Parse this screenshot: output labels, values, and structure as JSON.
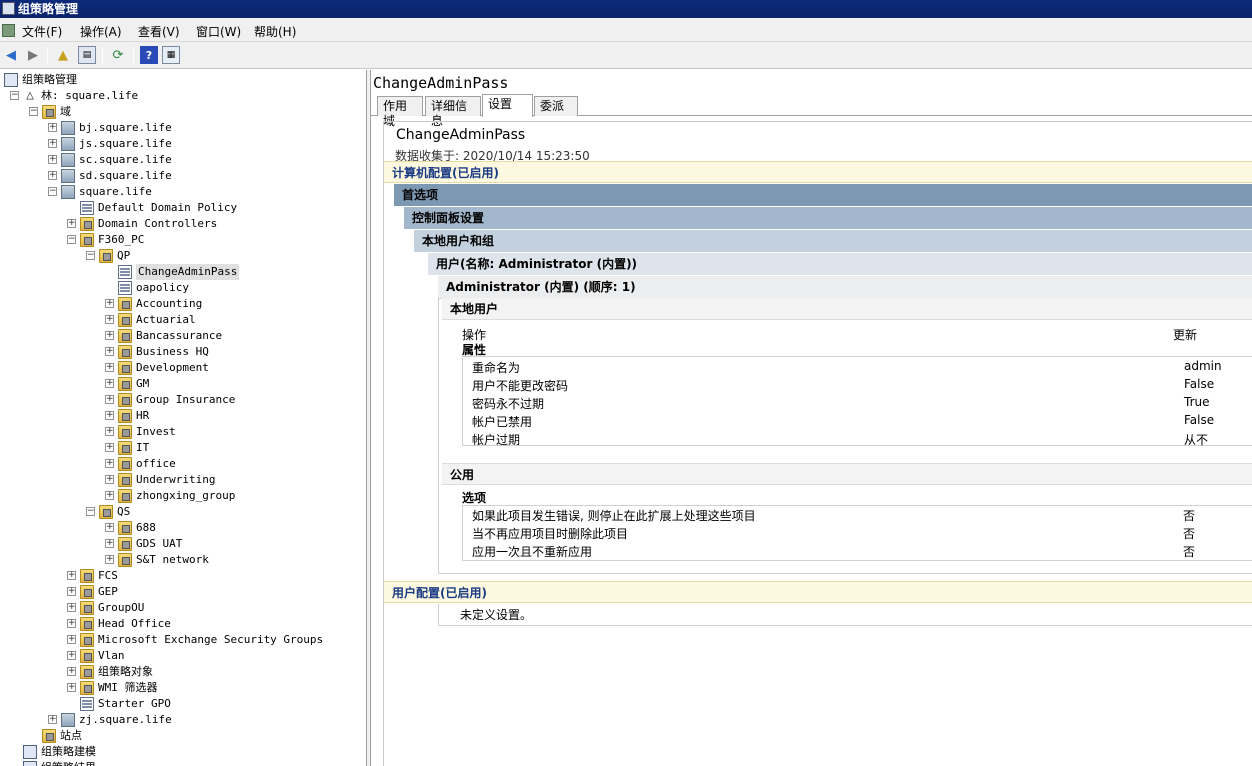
{
  "window": {
    "title": "组策略管理"
  },
  "menu": [
    "文件(F)",
    "操作(A)",
    "查看(V)",
    "窗口(W)",
    "帮助(H)"
  ],
  "toolbar": [
    "back-arrow-icon",
    "forward-arrow-icon",
    "up-folder-icon",
    "show-hide-tree-icon",
    "refresh-icon",
    "help-icon",
    "properties-icon"
  ],
  "tree": [
    {
      "label": "组策略管理",
      "icon": "root",
      "depth": 0,
      "exp": ""
    },
    {
      "label": "林: square.life",
      "icon": "forest",
      "depth": 1,
      "exp": "-"
    },
    {
      "label": "域",
      "icon": "folder",
      "depth": 2,
      "exp": "-"
    },
    {
      "label": "bj.square.life",
      "icon": "domain",
      "depth": 3,
      "exp": "+"
    },
    {
      "label": "js.square.life",
      "icon": "domain",
      "depth": 3,
      "exp": "+"
    },
    {
      "label": "sc.square.life",
      "icon": "domain",
      "depth": 3,
      "exp": "+"
    },
    {
      "label": "sd.square.life",
      "icon": "domain",
      "depth": 3,
      "exp": "+"
    },
    {
      "label": "square.life",
      "icon": "domain",
      "depth": 3,
      "exp": "-"
    },
    {
      "label": "Default Domain Policy",
      "icon": "gpo",
      "depth": 4,
      "exp": ""
    },
    {
      "label": "Domain Controllers",
      "icon": "folder",
      "depth": 4,
      "exp": "+"
    },
    {
      "label": "F360_PC",
      "icon": "folder",
      "depth": 4,
      "exp": "-"
    },
    {
      "label": "QP",
      "icon": "folder",
      "depth": 5,
      "exp": "-"
    },
    {
      "label": "ChangeAdminPass",
      "icon": "gpo",
      "depth": 6,
      "exp": "",
      "selected": true
    },
    {
      "label": "oapolicy",
      "icon": "gpo",
      "depth": 6,
      "exp": ""
    },
    {
      "label": "Accounting",
      "icon": "folder",
      "depth": 6,
      "exp": "+"
    },
    {
      "label": "Actuarial",
      "icon": "folder",
      "depth": 6,
      "exp": "+"
    },
    {
      "label": "Bancassurance",
      "icon": "folder",
      "depth": 6,
      "exp": "+"
    },
    {
      "label": "Business HQ",
      "icon": "folder",
      "depth": 6,
      "exp": "+"
    },
    {
      "label": "Development",
      "icon": "folder",
      "depth": 6,
      "exp": "+"
    },
    {
      "label": "GM",
      "icon": "folder",
      "depth": 6,
      "exp": "+"
    },
    {
      "label": "Group Insurance",
      "icon": "folder",
      "depth": 6,
      "exp": "+"
    },
    {
      "label": "HR",
      "icon": "folder",
      "depth": 6,
      "exp": "+"
    },
    {
      "label": "Invest",
      "icon": "folder",
      "depth": 6,
      "exp": "+"
    },
    {
      "label": "IT",
      "icon": "folder",
      "depth": 6,
      "exp": "+"
    },
    {
      "label": "office",
      "icon": "folder",
      "depth": 6,
      "exp": "+"
    },
    {
      "label": "Underwriting",
      "icon": "folder",
      "depth": 6,
      "exp": "+"
    },
    {
      "label": "zhongxing_group",
      "icon": "folder",
      "depth": 6,
      "exp": "+"
    },
    {
      "label": "QS",
      "icon": "folder",
      "depth": 5,
      "exp": "-"
    },
    {
      "label": "688",
      "icon": "folder",
      "depth": 6,
      "exp": "+"
    },
    {
      "label": "GDS UAT",
      "icon": "folder",
      "depth": 6,
      "exp": "+"
    },
    {
      "label": "S&T network",
      "icon": "folder",
      "depth": 6,
      "exp": "+"
    },
    {
      "label": "FCS",
      "icon": "folder",
      "depth": 4,
      "exp": "+"
    },
    {
      "label": "GEP",
      "icon": "folder",
      "depth": 4,
      "exp": "+"
    },
    {
      "label": "GroupOU",
      "icon": "folder",
      "depth": 4,
      "exp": "+"
    },
    {
      "label": "Head Office",
      "icon": "folder",
      "depth": 4,
      "exp": "+"
    },
    {
      "label": "Microsoft Exchange Security Groups",
      "icon": "folder",
      "depth": 4,
      "exp": "+"
    },
    {
      "label": "Vlan",
      "icon": "folder",
      "depth": 4,
      "exp": "+"
    },
    {
      "label": "组策略对象",
      "icon": "folder",
      "depth": 4,
      "exp": "+"
    },
    {
      "label": "WMI 筛选器",
      "icon": "folder",
      "depth": 4,
      "exp": "+"
    },
    {
      "label": "Starter GPO",
      "icon": "gpo",
      "depth": 4,
      "exp": ""
    },
    {
      "label": "zj.square.life",
      "icon": "domain",
      "depth": 3,
      "exp": "+"
    },
    {
      "label": "站点",
      "icon": "folder",
      "depth": 2,
      "exp": ""
    },
    {
      "label": "组策略建模",
      "icon": "root",
      "depth": 1,
      "exp": ""
    },
    {
      "label": "组策略结果",
      "icon": "root",
      "depth": 1,
      "exp": ""
    }
  ],
  "right": {
    "title": "ChangeAdminPass",
    "tabs": [
      "作用域",
      "详细信息",
      "设置",
      "委派"
    ],
    "active_tab": 2,
    "report": {
      "title": "ChangeAdminPass",
      "collected": "数据收集于: 2020/10/14 15:23:50",
      "computer_config": "计算机配置(已启用)",
      "preferences": "首选项",
      "control_panel": "控制面板设置",
      "local_users_groups": "本地用户和组",
      "user_item": "用户(名称: Administrator (内置))",
      "admin_item": "Administrator (内置) (顺序: 1)",
      "local_user": "本地用户",
      "action_label": "操作",
      "action_value": "更新",
      "properties_label": "属性",
      "properties": [
        {
          "name": "重命名为",
          "value": "admin"
        },
        {
          "name": "用户不能更改密码",
          "value": "False"
        },
        {
          "name": "密码永不过期",
          "value": "True"
        },
        {
          "name": "帐户已禁用",
          "value": "False"
        },
        {
          "name": "帐户过期",
          "value": "从不"
        }
      ],
      "common": "公用",
      "options_label": "选项",
      "options": [
        {
          "name": "如果此项目发生错误, 则停止在此扩展上处理这些项目",
          "value": "否"
        },
        {
          "name": "当不再应用项目时删除此项目",
          "value": "否"
        },
        {
          "name": "应用一次且不重新应用",
          "value": "否"
        }
      ],
      "user_config": "用户配置(已启用)",
      "no_settings": "未定义设置。"
    }
  },
  "colors": {
    "titlebar": "#0a246a",
    "config_band": "#fdf8e0",
    "config_text": "#1b3b84",
    "pref_band": "#7d98b3",
    "cp_band": "#a3b7cc",
    "lug_band": "#c3d0de",
    "user_band": "#dde4ec",
    "admin_band": "#ecedef"
  }
}
